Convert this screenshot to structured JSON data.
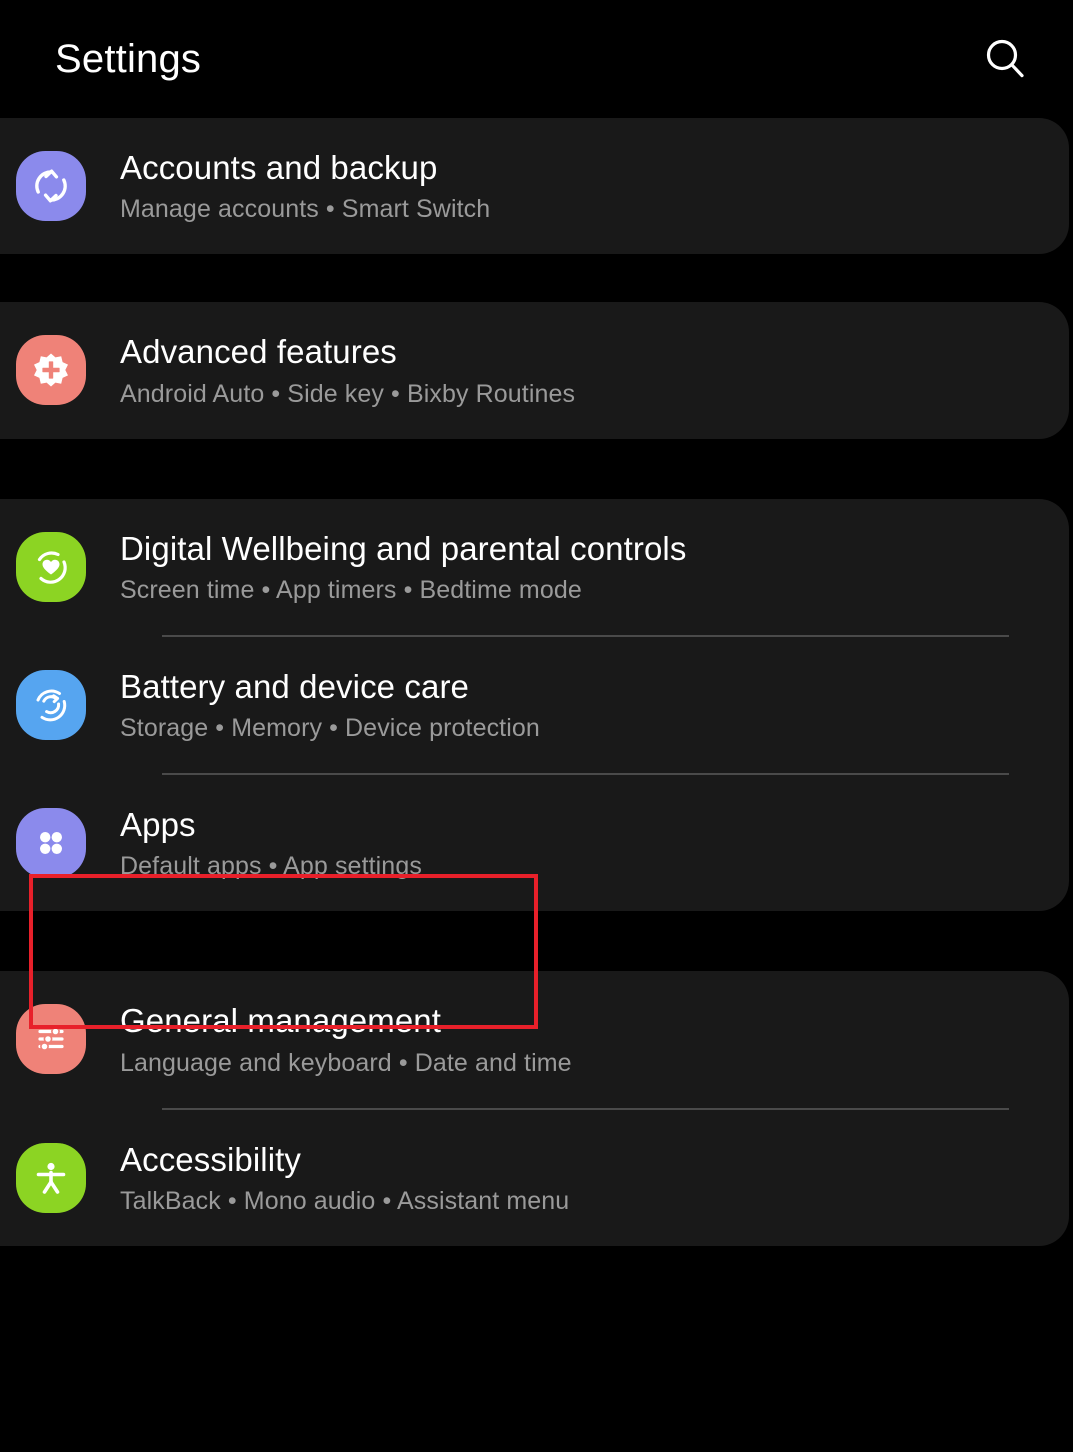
{
  "header": {
    "title": "Settings",
    "search_icon": "search-icon"
  },
  "sections": [
    {
      "id": "accounts-section",
      "items": [
        {
          "id": "accounts-and-backup",
          "title": "Accounts and backup",
          "subtitle": "Manage accounts  •  Smart Switch",
          "icon": "sync-icon",
          "icon_bg": "#8b8aec"
        }
      ]
    },
    {
      "id": "advanced-section",
      "items": [
        {
          "id": "advanced-features",
          "title": "Advanced features",
          "subtitle": "Android Auto  •  Side key  •  Bixby Routines",
          "icon": "gear-plus-icon",
          "icon_bg": "#ef8278"
        }
      ]
    },
    {
      "id": "wellbeing-section",
      "items": [
        {
          "id": "digital-wellbeing-and-parental-controls",
          "title": "Digital Wellbeing and parental controls",
          "subtitle": "Screen time  •  App timers  •  Bedtime mode",
          "icon": "heart-ring-icon",
          "icon_bg": "#8cd423"
        },
        {
          "id": "battery-and-device-care",
          "title": "Battery and device care",
          "subtitle": "Storage  •  Memory  •  Device protection",
          "icon": "device-care-icon",
          "icon_bg": "#56a5f0"
        },
        {
          "id": "apps",
          "title": "Apps",
          "subtitle": "Default apps  •  App settings",
          "icon": "apps-grid-icon",
          "icon_bg": "#8b8aec"
        }
      ]
    },
    {
      "id": "general-section",
      "items": [
        {
          "id": "general-management",
          "title": "General management",
          "subtitle": "Language and keyboard  •  Date and time",
          "icon": "sliders-icon",
          "icon_bg": "#ef8278"
        },
        {
          "id": "accessibility",
          "title": "Accessibility",
          "subtitle": "TalkBack  •  Mono audio  •  Assistant menu",
          "icon": "accessibility-person-icon",
          "icon_bg": "#8cd423"
        }
      ]
    }
  ],
  "annotation": {
    "target": "apps",
    "color": "#e8202a"
  },
  "colors": {
    "background": "#000000",
    "card": "#191919",
    "title_text": "#ffffff",
    "subtitle_text": "#9a9a9a",
    "divider": "#4a4a4a"
  }
}
